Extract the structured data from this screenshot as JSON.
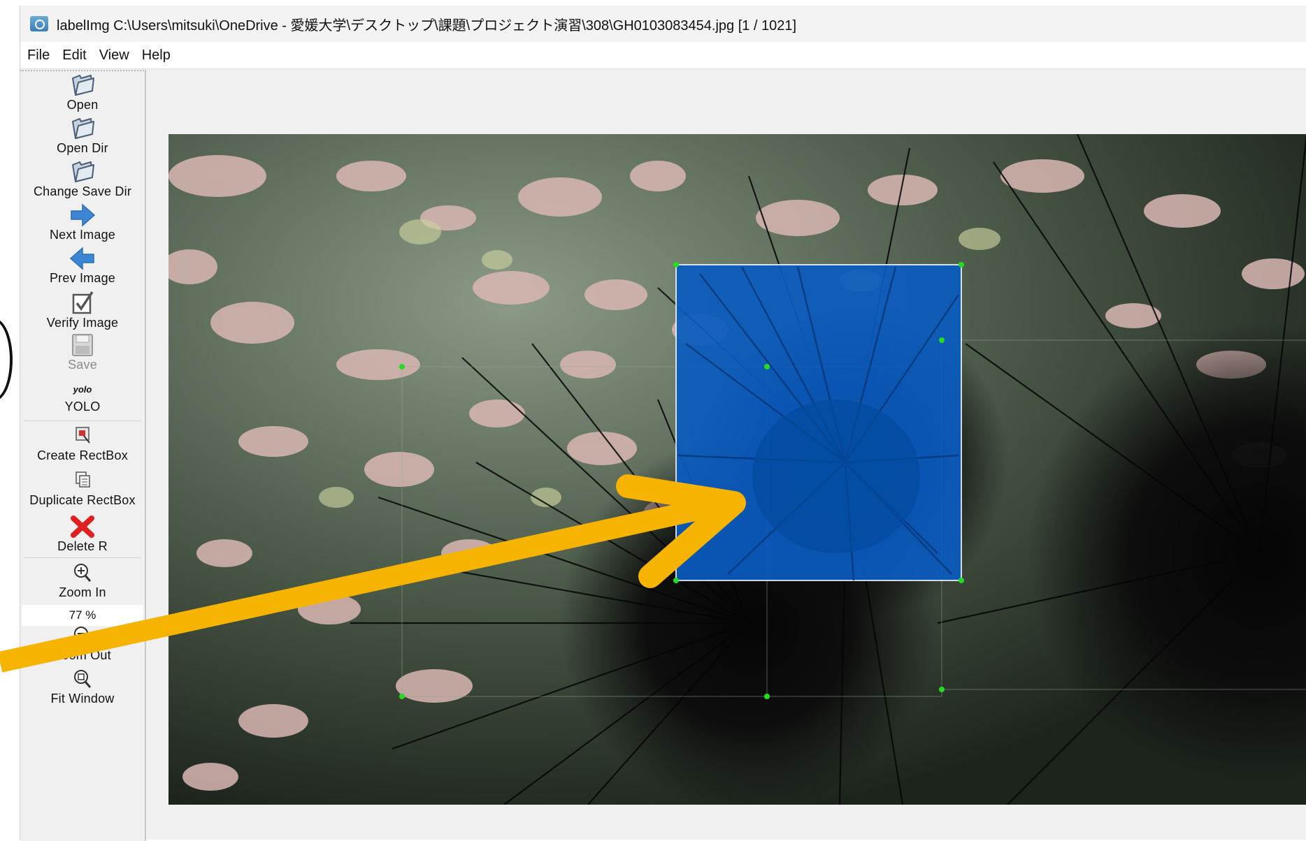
{
  "window": {
    "title": "labelImg C:\\Users\\mitsuki\\OneDrive - 愛媛大学\\デスクトップ\\課題\\プロジェクト演習\\308\\GH0103083454.jpg [1 / 1021]"
  },
  "menu": [
    "File",
    "Edit",
    "View",
    "Help"
  ],
  "toolbar": {
    "open": "Open",
    "open_dir": "Open Dir",
    "change_save_dir": "Change Save Dir",
    "next_image": "Next Image",
    "prev_image": "Prev Image",
    "verify_image": "Verify Image",
    "save": "Save",
    "format_icon_text": "yolo",
    "format": "YOLO",
    "create_rectbox": "Create RectBox",
    "duplicate_rectbox": "Duplicate RectBox",
    "delete_rectbox": "Delete R",
    "zoom_in": "Zoom In",
    "zoom_level": "77 %",
    "zoom_out": "Zoom Out",
    "fit_window": "Fit Window"
  },
  "colors": {
    "selected_box_fill": "#0a5cc0",
    "annotation_arrow": "#f6b400",
    "vertex_handle": "#22dd22",
    "delete_icon": "#e02020",
    "nav_arrow": "#3d86d6"
  },
  "icons": {
    "open": "folder-icon",
    "open_dir": "folder-icon",
    "change_save_dir": "folder-icon",
    "next_image": "arrow-right-icon",
    "prev_image": "arrow-left-icon",
    "verify_image": "checkbox-icon",
    "save": "floppy-icon",
    "create_rectbox": "create-rect-icon",
    "duplicate_rectbox": "duplicate-icon",
    "delete_rectbox": "delete-x-icon",
    "zoom_in": "zoom-in-icon",
    "zoom_out": "zoom-out-icon",
    "fit_window": "fit-window-icon"
  }
}
